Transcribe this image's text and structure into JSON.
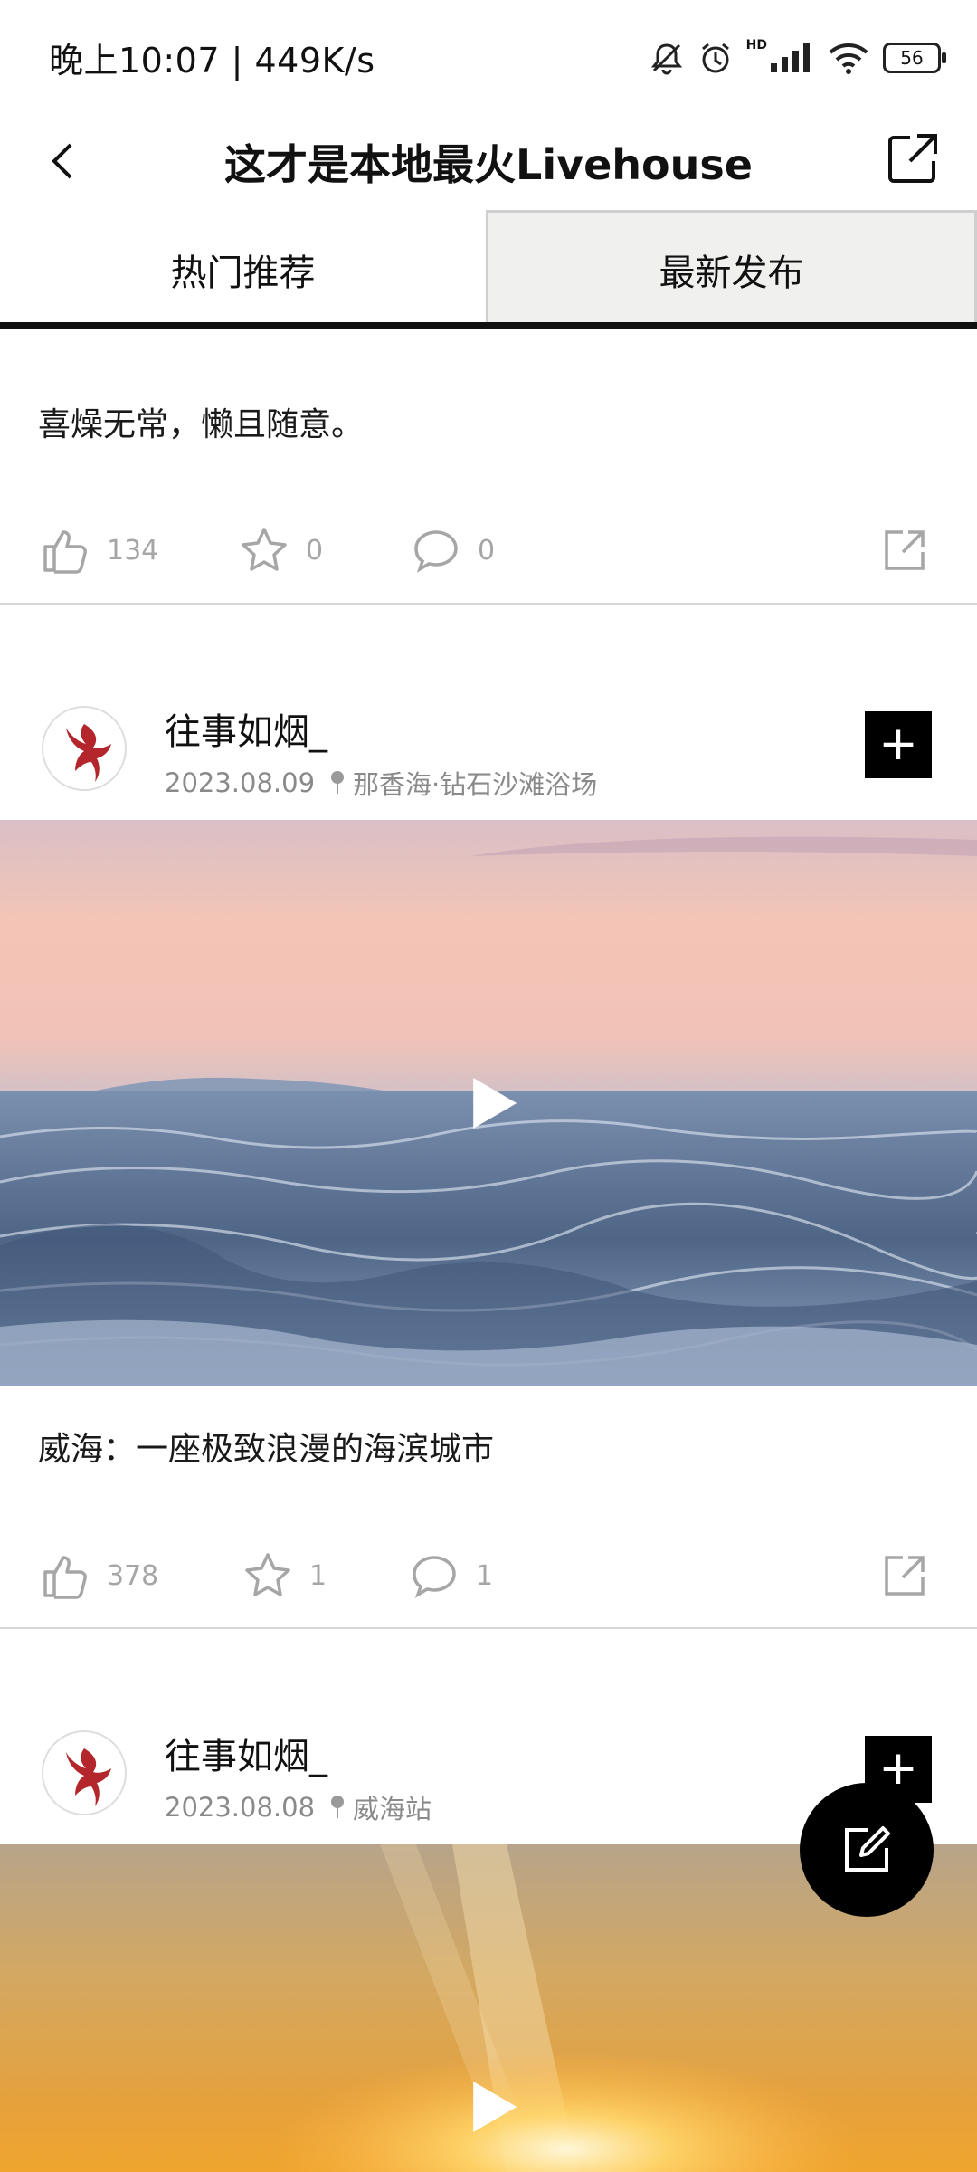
{
  "status_bar": {
    "time": "晚上10:07 | 449K/s",
    "hd": "HD",
    "battery": "56"
  },
  "header": {
    "title": "这才是本地最火Livehouse",
    "back_icon": "chevron-left-icon",
    "share_icon": "share-icon"
  },
  "tabs": [
    {
      "label": "热门推荐",
      "active": true
    },
    {
      "label": "最新发布",
      "active": false
    }
  ],
  "posts": [
    {
      "text": "喜燥无常，懒且随意。",
      "likes": "134",
      "favorites": "0",
      "comments": "0"
    },
    {
      "user": "往事如烟_",
      "date": "2023.08.09",
      "location": "那香海·钻石沙滩浴场",
      "text": "威海：一座极致浪漫的海滨城市",
      "likes": "378",
      "favorites": "1",
      "comments": "1"
    },
    {
      "user": "往事如烟_",
      "date": "2023.08.08",
      "location": "威海站"
    }
  ],
  "colors": {
    "accent": "#000000",
    "muted_text": "#8a8a8a",
    "tab_inactive_bg": "#f0f1ef"
  }
}
